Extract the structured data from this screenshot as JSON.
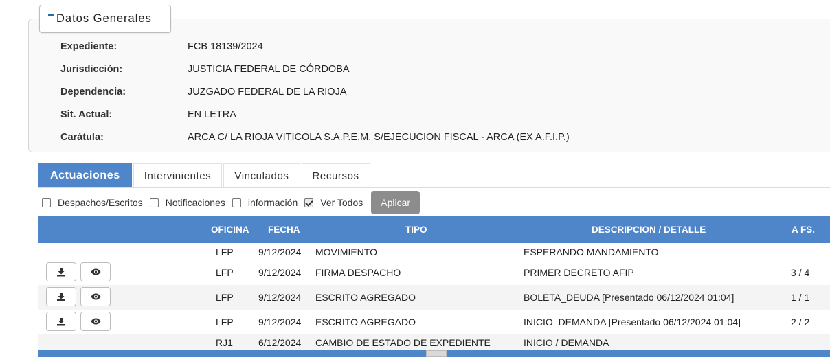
{
  "general": {
    "legend": "Datos Generales",
    "fields": [
      {
        "label": "Expediente:",
        "value": "FCB 18139/2024"
      },
      {
        "label": "Jurisdicción:",
        "value": "JUSTICIA FEDERAL DE CÓRDOBA"
      },
      {
        "label": "Dependencia:",
        "value": "JUZGADO FEDERAL DE LA RIOJA"
      },
      {
        "label": "Sit. Actual:",
        "value": "EN LETRA"
      },
      {
        "label": "Carátula:",
        "value": "ARCA C/ LA RIOJA VITICOLA S.A.P.E.M. S/EJECUCION FISCAL - ARCA (EX A.F.I.P.)"
      }
    ]
  },
  "tabs": [
    {
      "label": "Actuaciones",
      "active": true
    },
    {
      "label": "Intervinientes",
      "active": false
    },
    {
      "label": "Vinculados",
      "active": false
    },
    {
      "label": "Recursos",
      "active": false
    }
  ],
  "filters": {
    "options": [
      {
        "label": "Despachos/Escritos",
        "checked": false
      },
      {
        "label": "Notificaciones",
        "checked": false
      },
      {
        "label": "información",
        "checked": false
      },
      {
        "label": "Ver Todos",
        "checked": true
      }
    ],
    "apply_label": "Aplicar"
  },
  "table": {
    "headers": {
      "oficina": "OFICINA",
      "fecha": "FECHA",
      "tipo": "TIPO",
      "descripcion": "DESCRIPCION / DETALLE",
      "afs": "A FS."
    },
    "rows": [
      {
        "oficina": "LFP",
        "fecha": "9/12/2024",
        "tipo": "MOVIMIENTO",
        "descripcion": "ESPERANDO MANDAMIENTO",
        "afs": "",
        "actions": false
      },
      {
        "oficina": "LFP",
        "fecha": "9/12/2024",
        "tipo": "FIRMA DESPACHO",
        "descripcion": "PRIMER DECRETO AFIP",
        "afs": "3 / 4",
        "actions": true
      },
      {
        "oficina": "LFP",
        "fecha": "9/12/2024",
        "tipo": "ESCRITO AGREGADO",
        "descripcion": "BOLETA_DEUDA [Presentado 06/12/2024 01:04]",
        "afs": "1 / 1",
        "actions": true
      },
      {
        "oficina": "LFP",
        "fecha": "9/12/2024",
        "tipo": "ESCRITO AGREGADO",
        "descripcion": "INICIO_DEMANDA [Presentado 06/12/2024 01:04]",
        "afs": "2 / 2",
        "actions": true
      },
      {
        "oficina": "RJ1",
        "fecha": "6/12/2024",
        "tipo": "CAMBIO DE ESTADO DE EXPEDIENTE",
        "descripcion": "INICIO / DEMANDA",
        "afs": "",
        "actions": false
      }
    ]
  },
  "icons": {
    "download": "download-icon",
    "view": "eye-icon",
    "collapse": "minus-icon"
  }
}
